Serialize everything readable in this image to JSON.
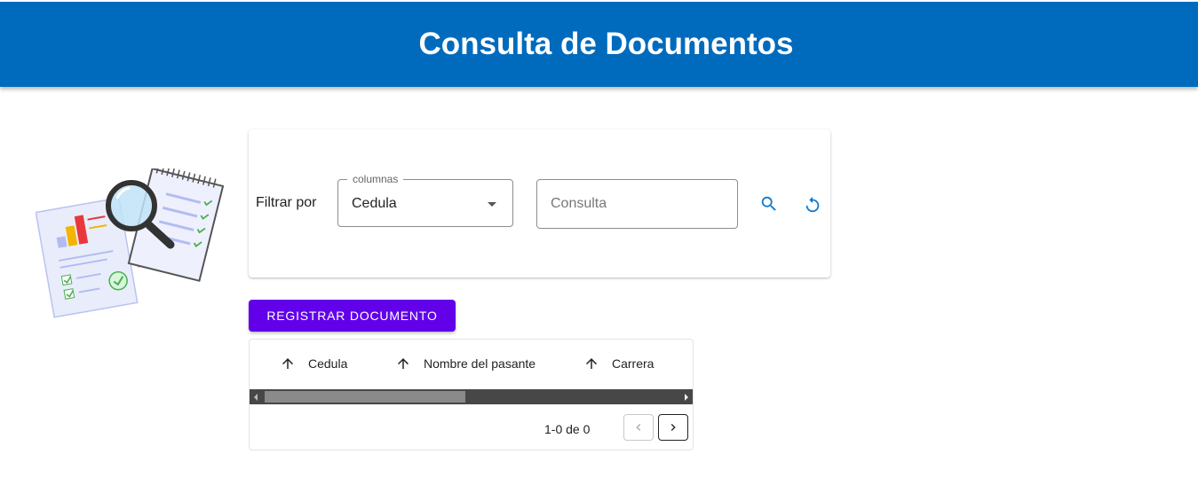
{
  "header": {
    "title": "Consulta de Documentos"
  },
  "filter": {
    "label": "Filtrar por",
    "column_select": {
      "legend": "columnas",
      "value": "Cedula"
    },
    "query": {
      "value": "",
      "placeholder": "Consulta"
    }
  },
  "actions": {
    "register_label": "REGISTRAR DOCUMENTO"
  },
  "table": {
    "columns": [
      "Cedula",
      "Nombre del pasante",
      "Carrera"
    ],
    "rows": [],
    "pagination": {
      "info": "1-0 de 0"
    }
  },
  "colors": {
    "header_bg": "#006bbd",
    "primary_button": "#6200ea",
    "icon_accent": "#1479c9"
  },
  "icons": {
    "illustration": "document-analysis-illustration",
    "search": "search-icon",
    "reset": "refresh-icon",
    "sort": "arrow-up-icon",
    "prev": "chevron-left-icon",
    "next": "chevron-right-icon"
  }
}
